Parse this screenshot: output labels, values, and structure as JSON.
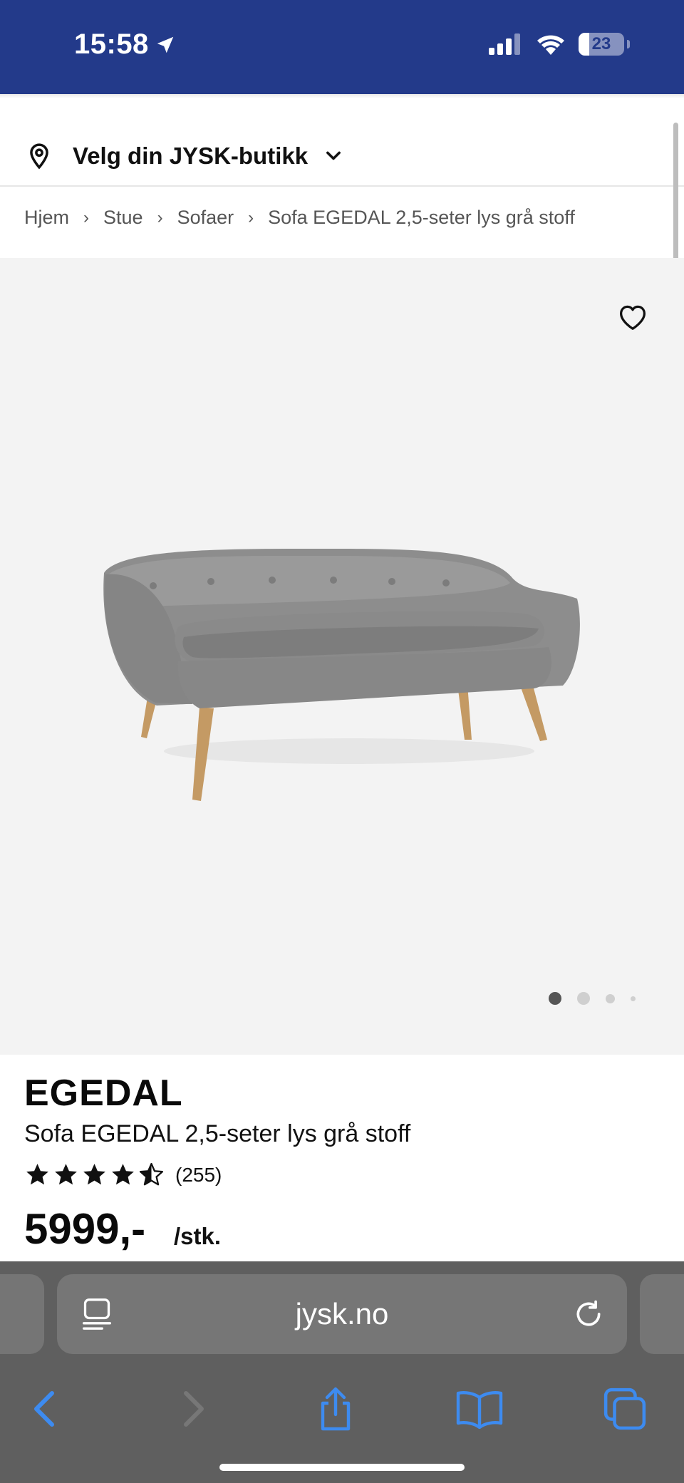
{
  "status_bar": {
    "time": "15:58",
    "battery": "23"
  },
  "store_selector": {
    "label": "Velg din JYSK-butikk"
  },
  "breadcrumb": [
    {
      "label": "Hjem"
    },
    {
      "label": "Stue"
    },
    {
      "label": "Sofaer"
    },
    {
      "label": "Sofa EGEDAL 2,5-seter lys grå stoff"
    }
  ],
  "gallery": {
    "image_count": 4,
    "active_index": 0
  },
  "product": {
    "brand": "EGEDAL",
    "name": "Sofa EGEDAL 2,5-seter lys grå stoff",
    "rating": 4.5,
    "review_count": "(255)",
    "price": "5999,-",
    "unit": "/stk."
  },
  "browser": {
    "url": "jysk.no"
  },
  "colors": {
    "header_blue": "#233a8a",
    "link_blue": "#3d8bf0",
    "browser_gray": "#5f5f5f"
  }
}
